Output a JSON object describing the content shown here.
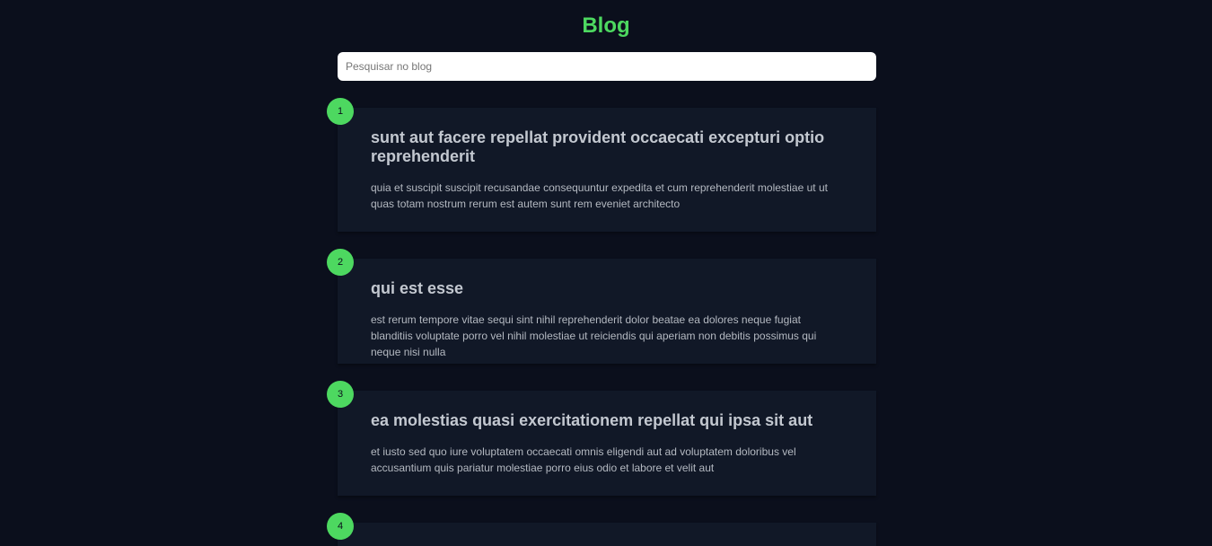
{
  "header": {
    "title": "Blog"
  },
  "search": {
    "placeholder": "Pesquisar no blog",
    "value": ""
  },
  "posts": [
    {
      "number": "1",
      "title": "sunt aut facere repellat provident occaecati excepturi optio reprehenderit",
      "body": "quia et suscipit suscipit recusandae consequuntur expedita et cum reprehenderit molestiae ut ut quas totam nostrum rerum est autem sunt rem eveniet architecto"
    },
    {
      "number": "2",
      "title": "qui est esse",
      "body": "est rerum tempore vitae sequi sint nihil reprehenderit dolor beatae ea dolores neque fugiat blanditiis voluptate porro vel nihil molestiae ut reiciendis qui aperiam non debitis possimus qui neque nisi nulla"
    },
    {
      "number": "3",
      "title": "ea molestias quasi exercitationem repellat qui ipsa sit aut",
      "body": "et iusto sed quo iure voluptatem occaecati omnis eligendi aut ad voluptatem doloribus vel accusantium quis pariatur molestiae porro eius odio et labore et velit aut"
    },
    {
      "number": "4",
      "title": "",
      "body": ""
    }
  ],
  "colors": {
    "background": "#0b0f1c",
    "card": "#111827",
    "accent": "#4dd860",
    "text": "#c3c8d0"
  }
}
